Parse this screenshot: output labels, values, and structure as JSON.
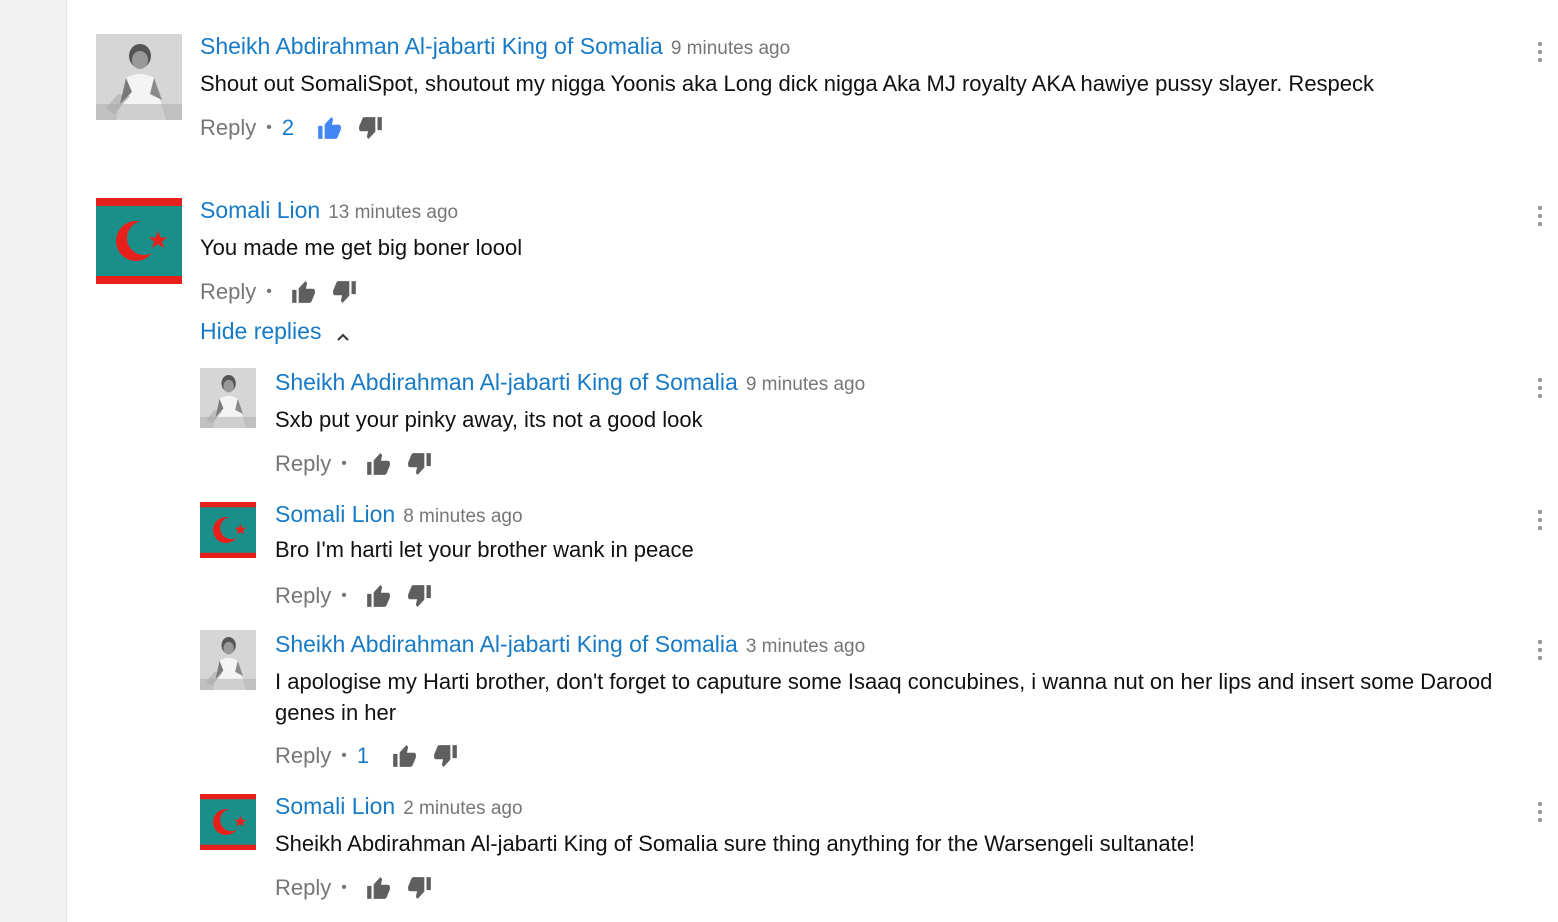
{
  "comments": [
    {
      "author": "Sheikh Abdirahman Al-jabarti King of Somalia",
      "time": "9 minutes ago",
      "text": "Shout out SomaliSpot, shoutout my nigga Yoonis aka Long dick nigga Aka MJ royalty AKA hawiye pussy slayer. Respeck",
      "reply_label": "Reply",
      "likes": "2",
      "avatar": "photo-avatar"
    },
    {
      "author": "Somali Lion",
      "time": "13 minutes ago",
      "text": "You made me get big boner loool",
      "reply_label": "Reply",
      "likes": "",
      "avatar": "flag-avatar",
      "hide_replies_label": "Hide replies"
    }
  ],
  "replies": [
    {
      "author": "Sheikh Abdirahman Al-jabarti King of Somalia",
      "time": "9 minutes ago",
      "text": "Sxb put your pinky away, its not a good look",
      "reply_label": "Reply",
      "likes": "",
      "avatar": "photo-avatar"
    },
    {
      "author": "Somali Lion",
      "time": "8 minutes ago",
      "text": "Bro I'm harti let your brother wank in peace",
      "reply_label": "Reply",
      "likes": "",
      "avatar": "flag-avatar"
    },
    {
      "author": "Sheikh Abdirahman Al-jabarti King of Somalia",
      "time": "3 minutes ago",
      "text": "I apologise my Harti brother, don't forget to caputure some Isaaq concubines, i wanna nut on her lips and insert some Darood genes in her",
      "reply_label": "Reply",
      "likes": "1",
      "avatar": "photo-avatar"
    },
    {
      "author": "Somali Lion",
      "time": "2 minutes ago",
      "text": "Sheikh Abdirahman Al-jabarti King of Somalia sure thing anything for the Warsengeli sultanate!",
      "reply_label": "Reply",
      "likes": "",
      "avatar": "flag-avatar"
    }
  ],
  "colors": {
    "link_blue": "#167ac6",
    "muted_gray": "#767676",
    "like_active": "#4285f4",
    "flag_teal": "#1a8f8a",
    "flag_red": "#e8201b"
  }
}
